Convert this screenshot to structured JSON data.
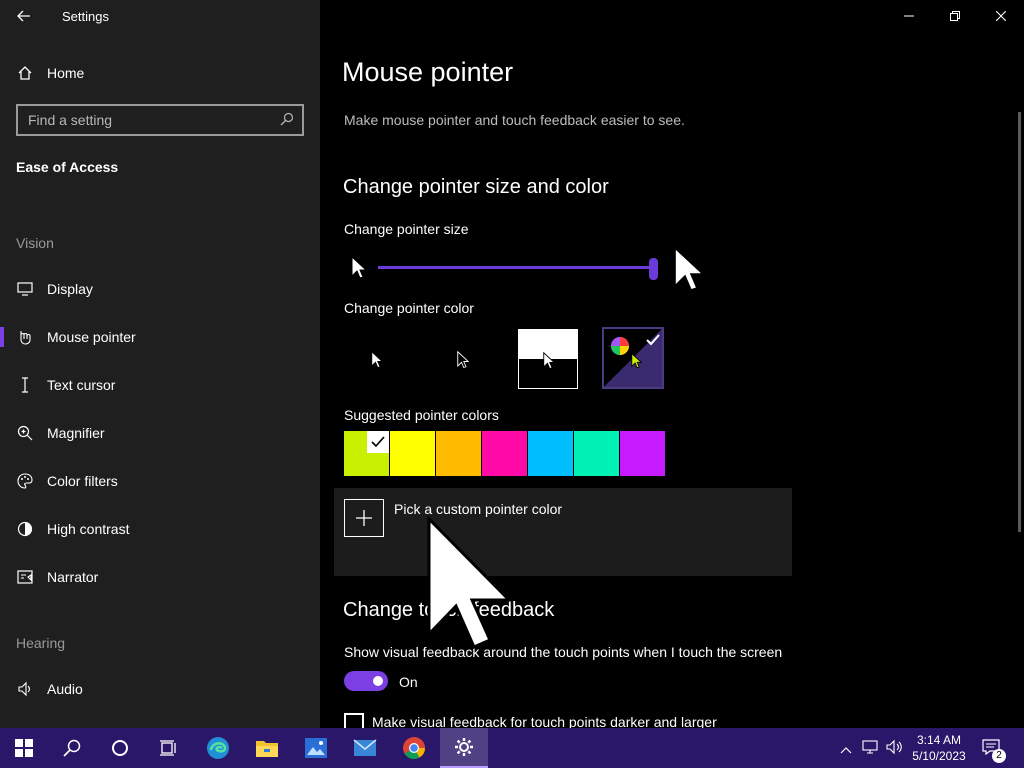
{
  "window": {
    "title": "Settings",
    "back_icon": "back-arrow-icon",
    "minimize_icon": "minimize-icon",
    "restore_icon": "restore-icon",
    "close_icon": "close-icon"
  },
  "sidebar": {
    "home_label": "Home",
    "search_placeholder": "Find a setting",
    "category": "Ease of Access",
    "vision_heading": "Vision",
    "hearing_heading": "Hearing",
    "vision_items": [
      {
        "label": "Display",
        "icon": "monitor-icon"
      },
      {
        "label": "Mouse pointer",
        "icon": "mouse-pointer-icon",
        "active": true
      },
      {
        "label": "Text cursor",
        "icon": "text-cursor-icon"
      },
      {
        "label": "Magnifier",
        "icon": "magnifier-icon"
      },
      {
        "label": "Color filters",
        "icon": "color-filters-icon"
      },
      {
        "label": "High contrast",
        "icon": "high-contrast-icon"
      },
      {
        "label": "Narrator",
        "icon": "narrator-icon"
      }
    ],
    "hearing_items": [
      {
        "label": "Audio",
        "icon": "audio-icon"
      }
    ]
  },
  "main": {
    "title": "Mouse pointer",
    "description": "Make mouse pointer and touch feedback easier to see.",
    "section1": "Change pointer size and color",
    "size_label": "Change pointer size",
    "size_value_fraction": 1.0,
    "color_label": "Change pointer color",
    "color_options": [
      "white",
      "black",
      "inverted",
      "custom"
    ],
    "selected_color_option": "custom",
    "suggested_label": "Suggested pointer colors",
    "suggested_colors": [
      "#c8f000",
      "#ffff00",
      "#ffbb00",
      "#ff0aa6",
      "#00bfff",
      "#00f2b5",
      "#c61aff"
    ],
    "selected_suggested_index": 0,
    "custom_color_label": "Pick a custom pointer color",
    "section2": "Change touch feedback",
    "touch_label": "Show visual feedback around the touch points when I touch the screen",
    "touch_toggle": "On",
    "darker_label": "Make visual feedback for touch points darker and larger"
  },
  "taskbar": {
    "items": [
      "start-icon",
      "search-icon",
      "cortana-icon",
      "task-view-icon",
      "edge-icon",
      "file-explorer-icon",
      "photos-icon",
      "mail-icon",
      "chrome-icon",
      "settings-icon"
    ],
    "time": "3:14 AM",
    "date": "5/10/2023",
    "notifications": "2"
  }
}
